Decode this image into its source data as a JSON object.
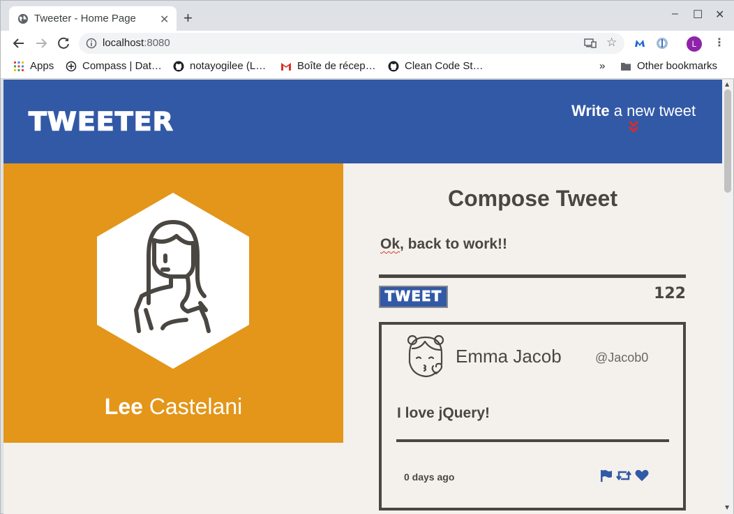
{
  "browser": {
    "tab_title": "Tweeter - Home Page",
    "tab_close": "✕",
    "new_tab": "+",
    "window_controls": {
      "minimize": "–",
      "maximize": "☐",
      "close": "✕"
    },
    "url_host": "localhost",
    "url_port": ":8080",
    "profile_initial": "L",
    "bookmarks": [
      {
        "label": "Apps",
        "icon": "apps-grid-icon"
      },
      {
        "label": "Compass | Dat…",
        "icon": "compass-icon"
      },
      {
        "label": "notayogilee (L…",
        "icon": "github-icon"
      },
      {
        "label": "Boîte de récep…",
        "icon": "gmail-icon"
      },
      {
        "label": "Clean Code St…",
        "icon": "github-icon"
      }
    ],
    "bookmarks_overflow": "»",
    "other_bookmarks": "Other bookmarks"
  },
  "header": {
    "logo": "Tweeter",
    "write_bold": "Write",
    "write_rest": " a new tweet"
  },
  "profile": {
    "first_name": "Lee",
    "last_name": " Castelani"
  },
  "compose": {
    "title": "Compose Tweet",
    "text_misspelled": "Ok",
    "text_rest": ", back to work!!",
    "button_label": "Tweet",
    "counter": "122"
  },
  "tweets": [
    {
      "name": "Emma Jacob",
      "handle": "@Jacob0",
      "content": "I love jQuery!",
      "time": "0 days ago"
    }
  ],
  "colors": {
    "header_blue": "#3259a6",
    "profile_orange": "#e39619",
    "page_bg": "#f4f1ec",
    "text_dark": "#4a4641",
    "chevron_red": "#e0282a"
  }
}
